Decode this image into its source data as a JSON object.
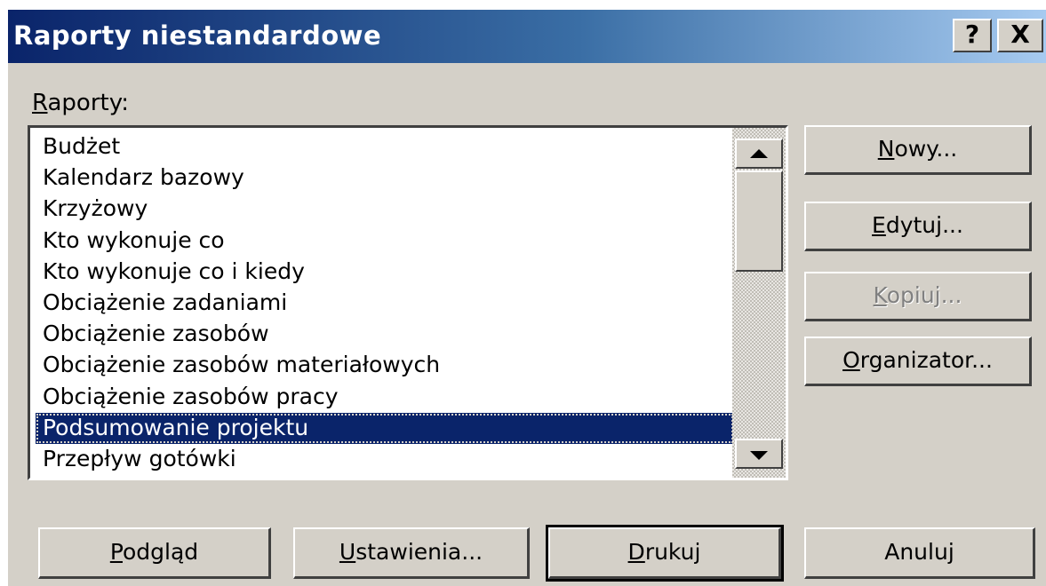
{
  "window": {
    "title": "Raporty niestandardowe",
    "help_label": "?",
    "close_label": "X"
  },
  "reports": {
    "label_mnemonic": "R",
    "label_rest": "aporty:",
    "items": [
      "Budżet",
      "Kalendarz bazowy",
      "Krzyżowy",
      "Kto wykonuje co",
      "Kto wykonuje co i kiedy",
      "Obciążenie zadaniami",
      "Obciążenie zasobów",
      "Obciążenie zasobów materiałowych",
      "Obciążenie zasobów pracy",
      "Podsumowanie projektu",
      "Przepływ gotówki"
    ],
    "selected_index": 9
  },
  "side_buttons": {
    "nowy": {
      "mnemonic": "N",
      "rest": "owy..."
    },
    "edytuj": {
      "mnemonic": "E",
      "rest": "dytuj..."
    },
    "kopiuj": {
      "mnemonic": "K",
      "rest": "opiuj...",
      "disabled": true
    },
    "organizator": {
      "mnemonic": "O",
      "rest": "rganizator..."
    }
  },
  "bottom_buttons": {
    "podglad": {
      "mnemonic": "P",
      "rest": "odgląd"
    },
    "ustawienia": {
      "mnemonic": "U",
      "rest": "stawienia..."
    },
    "drukuj": {
      "mnemonic": "D",
      "rest": "rukuj"
    },
    "anuluj": {
      "label": "Anuluj"
    }
  }
}
